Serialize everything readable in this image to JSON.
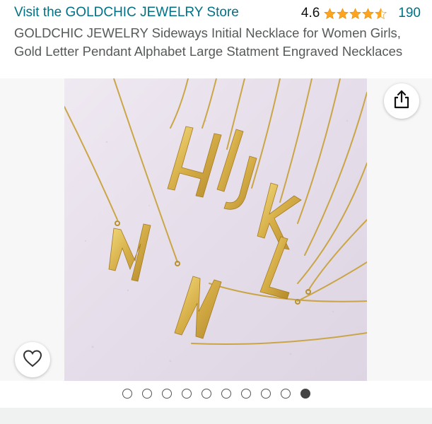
{
  "store": {
    "link_text": "Visit the GOLDCHIC JEWELRY Store"
  },
  "rating": {
    "value": "4.6",
    "stars_out_of_5": 4.6,
    "review_count": "190",
    "star_color": "#FFA41C"
  },
  "product": {
    "title": "GOLDCHIC JEWELRY Sideways Initial Necklace for Women Girls, Gold Letter Pendant Alphabet Large Statment Engraved Necklaces"
  },
  "gallery": {
    "image_icon": "product-photo",
    "share_icon": "share-icon",
    "wishlist_icon": "heart-icon",
    "total_images": 10,
    "current_image": 10
  },
  "colors": {
    "link": "#007185",
    "text": "#0F1111",
    "title": "#565959"
  }
}
